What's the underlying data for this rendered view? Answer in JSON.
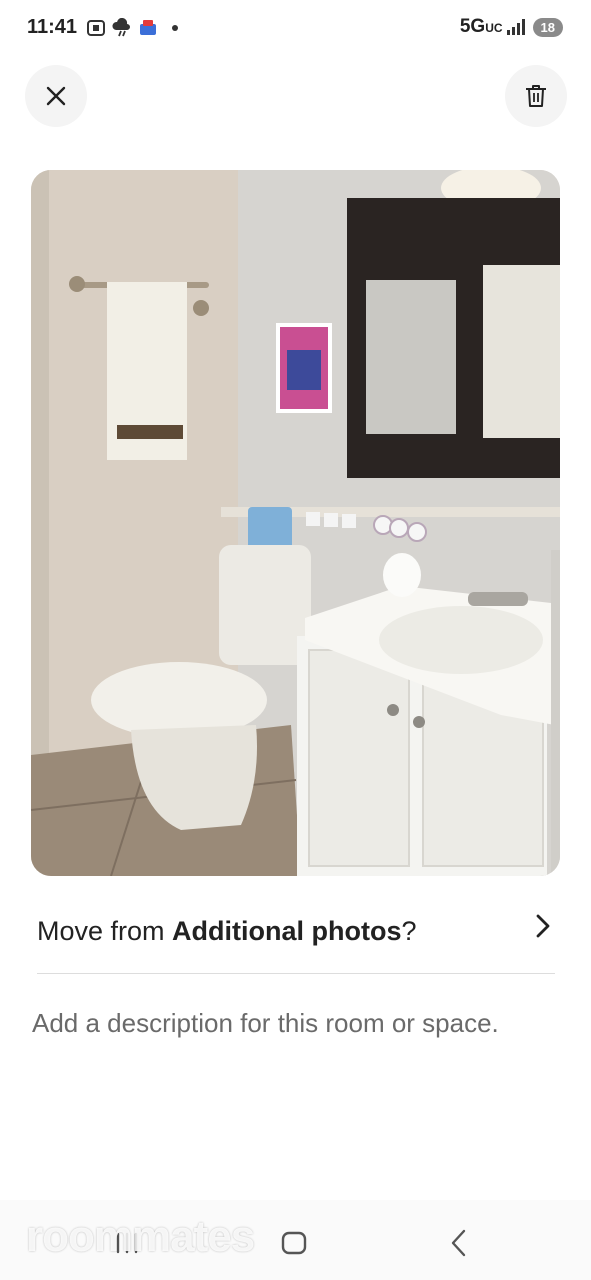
{
  "status_bar": {
    "time": "11:41",
    "network": "5G",
    "network_sub": "UC",
    "battery": "18",
    "icons": [
      "screenshot-icon",
      "weather-storm-icon",
      "app-notification-icon",
      "dot-icon",
      "signal-icon"
    ]
  },
  "header": {
    "close_icon": "close-icon",
    "delete_icon": "trash-icon"
  },
  "photo": {
    "subject": "bathroom photo"
  },
  "move_row": {
    "prefix": "Move from ",
    "album": "Additional photos",
    "suffix": "?"
  },
  "description": {
    "placeholder": "Add a description for this room or space."
  },
  "watermark": "roommates",
  "nav_bar": {
    "icons": [
      "recents-icon",
      "home-icon",
      "back-icon"
    ]
  },
  "colors": {
    "background": "#ffffff",
    "circle_button": "#f4f4f4",
    "text_primary": "#222222",
    "text_secondary": "#6a6a6a",
    "divider": "#dddddd"
  }
}
